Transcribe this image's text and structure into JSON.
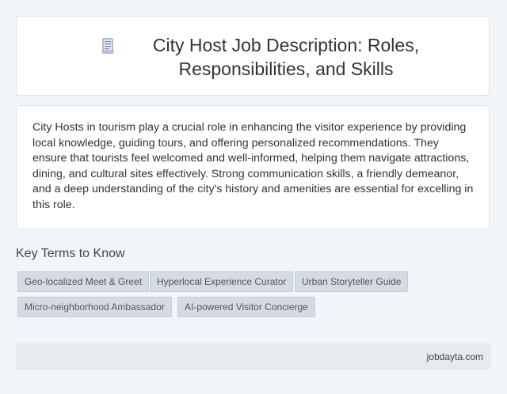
{
  "header": {
    "icon": "document-icon",
    "title": "City Host Job Description: Roles, Responsibilities, and Skills"
  },
  "description": "City Hosts in tourism play a crucial role in enhancing the visitor experience by providing local knowledge, guiding tours, and offering personalized recommendations. They ensure that tourists feel welcomed and well-informed, helping them navigate attractions, dining, and cultural sites effectively. Strong communication skills, a friendly demeanor, and a deep understanding of the city's history and amenities are essential for excelling in this role.",
  "key_terms": {
    "heading": "Key Terms to Know",
    "items": [
      "Geo-localized Meet & Greet",
      "Hyperlocal Experience Curator",
      "Urban Storyteller Guide",
      "Micro-neighborhood Ambassador",
      "AI-powered Visitor Concierge"
    ]
  },
  "footer": {
    "site": "jobdayta.com"
  }
}
